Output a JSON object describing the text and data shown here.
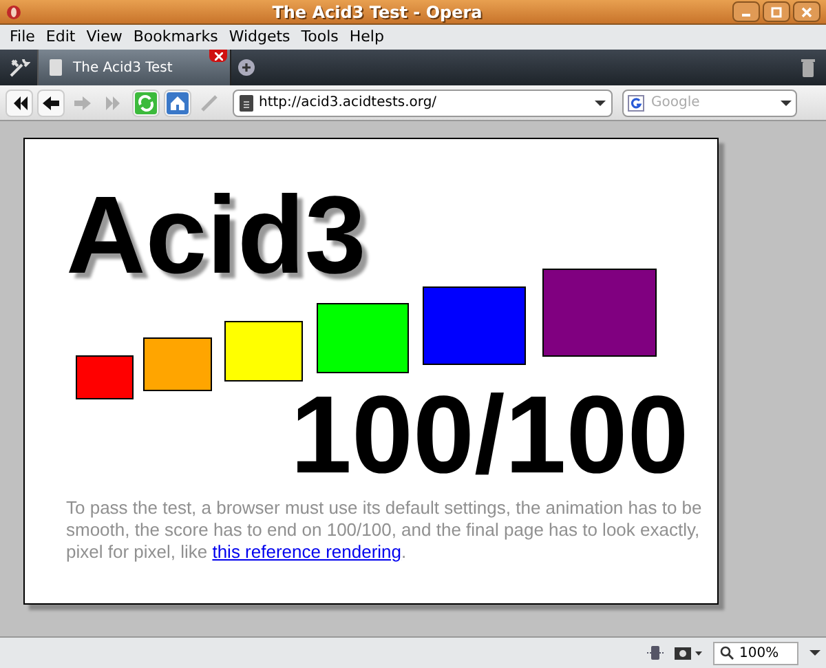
{
  "window": {
    "title": "The Acid3 Test - Opera"
  },
  "menu": [
    "File",
    "Edit",
    "View",
    "Bookmarks",
    "Widgets",
    "Tools",
    "Help"
  ],
  "tabs": [
    {
      "label": "The Acid3 Test",
      "selected": true
    }
  ],
  "toolbar": [
    {
      "kind": "rewind",
      "disabled": false
    },
    {
      "kind": "back",
      "disabled": false
    },
    {
      "kind": "forward",
      "disabled": true
    },
    {
      "kind": "fastforward",
      "disabled": true
    },
    {
      "kind": "reload",
      "disabled": false
    },
    {
      "kind": "home",
      "disabled": false
    },
    {
      "kind": "wand",
      "disabled": true
    }
  ],
  "address": {
    "value": "http://acid3.acidtests.org/"
  },
  "search": {
    "placeholder": "Google"
  },
  "page": {
    "heading": "Acid3",
    "score": "100/100",
    "squares": [
      {
        "color": "#ff0000"
      },
      {
        "color": "#ffa500"
      },
      {
        "color": "#ffff00"
      },
      {
        "color": "#00ff00"
      },
      {
        "color": "#0000ff"
      },
      {
        "color": "#800080"
      }
    ],
    "text_before": "To pass the test, a browser must use its default settings, the animation has to be smooth, the score has to end on 100/100, and the final page has to look exactly, pixel for pixel, like ",
    "link": "this reference rendering",
    "text_after": "."
  },
  "status_bar": {
    "zoom": "100%"
  }
}
